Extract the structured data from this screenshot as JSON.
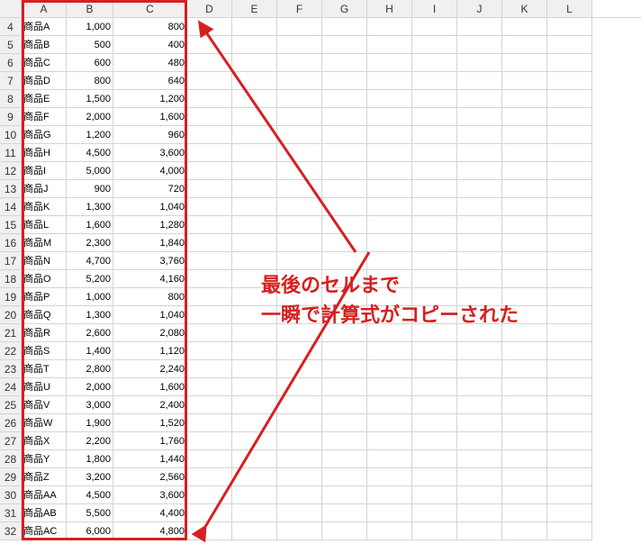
{
  "columns": [
    "A",
    "B",
    "C",
    "D",
    "E",
    "F",
    "G",
    "H",
    "I",
    "J",
    "K",
    "L"
  ],
  "col_widths": {
    "A": 50,
    "B": 52,
    "C": 82
  },
  "rows": [
    {
      "n": 4,
      "a": "商品A",
      "b": "1,000",
      "c": "800"
    },
    {
      "n": 5,
      "a": "商品B",
      "b": "500",
      "c": "400"
    },
    {
      "n": 6,
      "a": "商品C",
      "b": "600",
      "c": "480"
    },
    {
      "n": 7,
      "a": "商品D",
      "b": "800",
      "c": "640"
    },
    {
      "n": 8,
      "a": "商品E",
      "b": "1,500",
      "c": "1,200"
    },
    {
      "n": 9,
      "a": "商品F",
      "b": "2,000",
      "c": "1,600"
    },
    {
      "n": 10,
      "a": "商品G",
      "b": "1,200",
      "c": "960"
    },
    {
      "n": 11,
      "a": "商品H",
      "b": "4,500",
      "c": "3,600"
    },
    {
      "n": 12,
      "a": "商品I",
      "b": "5,000",
      "c": "4,000"
    },
    {
      "n": 13,
      "a": "商品J",
      "b": "900",
      "c": "720"
    },
    {
      "n": 14,
      "a": "商品K",
      "b": "1,300",
      "c": "1,040"
    },
    {
      "n": 15,
      "a": "商品L",
      "b": "1,600",
      "c": "1,280"
    },
    {
      "n": 16,
      "a": "商品M",
      "b": "2,300",
      "c": "1,840"
    },
    {
      "n": 17,
      "a": "商品N",
      "b": "4,700",
      "c": "3,760"
    },
    {
      "n": 18,
      "a": "商品O",
      "b": "5,200",
      "c": "4,160"
    },
    {
      "n": 19,
      "a": "商品P",
      "b": "1,000",
      "c": "800"
    },
    {
      "n": 20,
      "a": "商品Q",
      "b": "1,300",
      "c": "1,040"
    },
    {
      "n": 21,
      "a": "商品R",
      "b": "2,600",
      "c": "2,080"
    },
    {
      "n": 22,
      "a": "商品S",
      "b": "1,400",
      "c": "1,120"
    },
    {
      "n": 23,
      "a": "商品T",
      "b": "2,800",
      "c": "2,240"
    },
    {
      "n": 24,
      "a": "商品U",
      "b": "2,000",
      "c": "1,600"
    },
    {
      "n": 25,
      "a": "商品V",
      "b": "3,000",
      "c": "2,400"
    },
    {
      "n": 26,
      "a": "商品W",
      "b": "1,900",
      "c": "1,520"
    },
    {
      "n": 27,
      "a": "商品X",
      "b": "2,200",
      "c": "1,760"
    },
    {
      "n": 28,
      "a": "商品Y",
      "b": "1,800",
      "c": "1,440"
    },
    {
      "n": 29,
      "a": "商品Z",
      "b": "3,200",
      "c": "2,560"
    },
    {
      "n": 30,
      "a": "商品AA",
      "b": "4,500",
      "c": "3,600"
    },
    {
      "n": 31,
      "a": "商品AB",
      "b": "5,500",
      "c": "4,400"
    },
    {
      "n": 32,
      "a": "商品AC",
      "b": "6,000",
      "c": "4,800"
    }
  ],
  "annotation": {
    "line1": "最後のセルまで",
    "line2": "一瞬で計算式がコピーされた"
  },
  "colors": {
    "accent": "#d62020"
  }
}
